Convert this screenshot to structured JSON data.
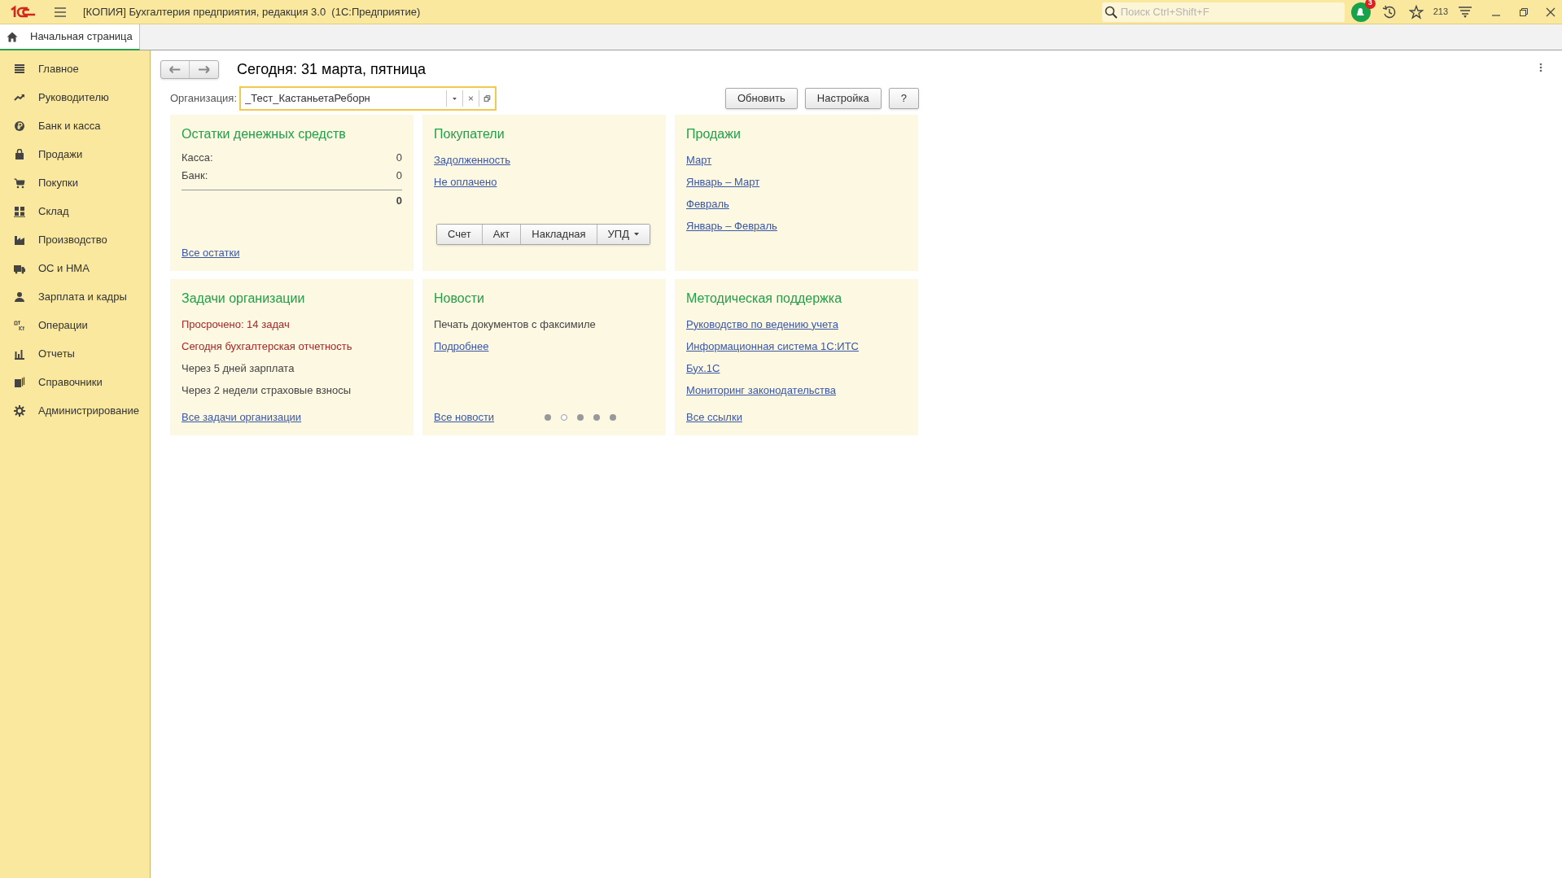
{
  "window": {
    "title": "[КОПИЯ] Бухгалтерия предприятия, редакция 3.0  (1С:Предприятие)",
    "search_placeholder": "Поиск Ctrl+Shift+F",
    "notification_count": "3",
    "counter": "213"
  },
  "tabs": [
    {
      "label": "Начальная страница",
      "selected": true
    }
  ],
  "sidebar": {
    "items": [
      {
        "label": "Главное"
      },
      {
        "label": "Руководителю"
      },
      {
        "label": "Банк и касса"
      },
      {
        "label": "Продажи"
      },
      {
        "label": "Покупки"
      },
      {
        "label": "Склад"
      },
      {
        "label": "Производство"
      },
      {
        "label": "ОС и НМА"
      },
      {
        "label": "Зарплата и кадры"
      },
      {
        "label": "Операции"
      },
      {
        "label": "Отчеты"
      },
      {
        "label": "Справочники"
      },
      {
        "label": "Администрирование"
      }
    ]
  },
  "page": {
    "title": "Сегодня: 31 марта, пятница",
    "organization": {
      "label": "Организация:",
      "value": "_Тест_КастаньетаРеборн"
    },
    "buttons": [
      "Обновить",
      "Настройка",
      "?"
    ]
  },
  "cards": [
    {
      "title": "Остатки денежных средств",
      "items": [
        {
          "kind": "value_row",
          "label": "Касса:",
          "value": "0"
        },
        {
          "kind": "value_row",
          "label": "Банк:",
          "value": "0"
        },
        {
          "kind": "total_row",
          "value": "0"
        }
      ],
      "footer_link": "Все остатки"
    },
    {
      "title": "Покупатели",
      "items": [
        {
          "kind": "link",
          "text": "Задолженность"
        },
        {
          "kind": "link",
          "text": "Не оплачено"
        },
        {
          "kind": "button_group",
          "buttons": [
            {
              "label": "Счет",
              "dropdown": false
            },
            {
              "label": "Акт",
              "dropdown": false
            },
            {
              "label": "Накладная",
              "dropdown": false
            },
            {
              "label": "УПД",
              "dropdown": true
            }
          ]
        }
      ]
    },
    {
      "title": "Продажи",
      "items": [
        {
          "kind": "link",
          "text": "Март"
        },
        {
          "kind": "link",
          "text": "Январь – Март"
        },
        {
          "kind": "link",
          "text": "Февраль"
        },
        {
          "kind": "link",
          "text": "Январь – Февраль"
        }
      ]
    },
    {
      "title": "Задачи организации",
      "items": [
        {
          "kind": "warning",
          "text": "Просрочено: 14 задач"
        },
        {
          "kind": "warning",
          "text": "Сегодня бухгалтерская отчетность"
        },
        {
          "kind": "text",
          "text": "Через 5 дней зарплата"
        },
        {
          "kind": "text",
          "text": "Через 2 недели страховые взносы"
        }
      ],
      "footer_link": "Все задачи организации"
    },
    {
      "title": "Новости",
      "items": [
        {
          "kind": "text",
          "text": "Печать документов с факсимиле"
        },
        {
          "kind": "link",
          "text": "Подробнее"
        }
      ],
      "footer_link": "Все новости",
      "pager": [
        {
          "selected": false
        },
        {
          "selected": true
        },
        {
          "selected": false
        },
        {
          "selected": false
        },
        {
          "selected": false
        }
      ]
    },
    {
      "title": "Методическая поддержка",
      "items": [
        {
          "kind": "link",
          "text": "Руководство по ведению учета"
        },
        {
          "kind": "link",
          "text": "Информационная система 1С:ИТС"
        },
        {
          "kind": "link",
          "text": "Бух.1С"
        },
        {
          "kind": "link",
          "text": "Мониторинг законодательства"
        }
      ],
      "footer_link": "Все ссылки"
    }
  ]
}
